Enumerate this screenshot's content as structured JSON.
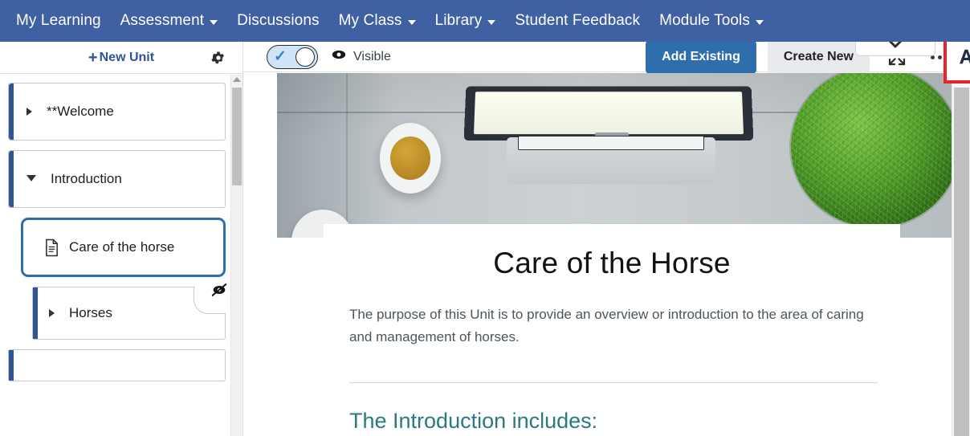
{
  "topnav": {
    "items": [
      {
        "label": "My Learning",
        "has_caret": false
      },
      {
        "label": "Assessment",
        "has_caret": true
      },
      {
        "label": "Discussions",
        "has_caret": false
      },
      {
        "label": "My Class",
        "has_caret": true
      },
      {
        "label": "Library",
        "has_caret": true
      },
      {
        "label": "Student Feedback",
        "has_caret": false
      },
      {
        "label": "Module Tools",
        "has_caret": true
      }
    ],
    "background_color": "#3f60a3"
  },
  "sidebar": {
    "new_unit_label": "New Unit",
    "new_unit_plus": "+",
    "gear_icon": "gear-icon",
    "items": [
      {
        "label": "**Welcome",
        "type": "unit",
        "expanded": false,
        "selected_bar": true
      },
      {
        "label": "Introduction",
        "type": "unit",
        "expanded": true,
        "selected_bar": true
      },
      {
        "label": "Care of the horse",
        "type": "page",
        "selected": true,
        "icon": "document-icon"
      },
      {
        "label": "Horses",
        "type": "subunit",
        "expanded": false,
        "hidden_icon": "eye-slash-icon"
      }
    ]
  },
  "toolbar": {
    "toggle_state": "on",
    "toggle_check": "✓",
    "visibility_label": "Visible",
    "visibility_icon": "eye-icon",
    "highlighted_tools": [
      {
        "icon": "text-size-down-icon",
        "label": "A"
      },
      {
        "icon": "read-aloud-icon"
      }
    ],
    "highlight_color": "#e8232a",
    "add_existing_label": "Add Existing",
    "create_new_label": "Create New",
    "expand_icon": "expand-fullscreen-icon",
    "more_icon": "more-options-icon",
    "chevron_icon": "chevron-down-icon",
    "primary_color": "#2f6ead"
  },
  "content": {
    "hero_image": "desk-flatlay-laptop-bowl-moss-photo",
    "title": "Care of the Horse",
    "paragraph": "The purpose of this Unit is to provide an overview or introduction to the area of caring and management of horses.",
    "section_heading": "The Introduction includes:",
    "section_heading_color": "#2a7a80"
  }
}
